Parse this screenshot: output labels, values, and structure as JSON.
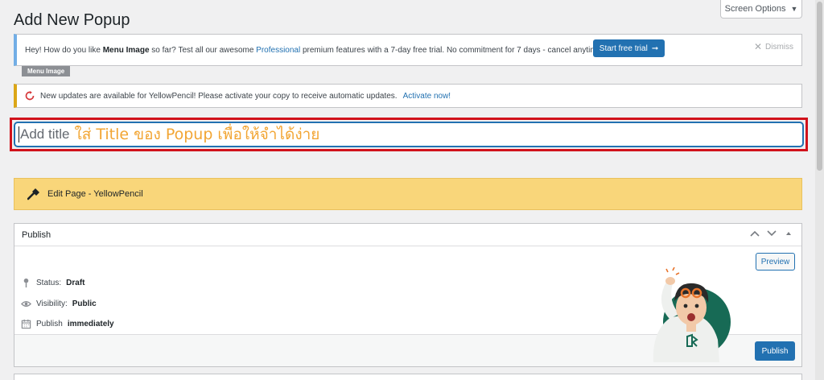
{
  "page": {
    "title": "Add New Popup"
  },
  "screen_options": {
    "label": "Screen Options",
    "caret_icon": "caret-down-icon"
  },
  "info_notice": {
    "text_1": "Hey! How do you like ",
    "product": "Menu Image",
    "text_2": " so far? Test all our awesome ",
    "link": "Professional",
    "text_3": " premium features with a 7-day free trial. No commitment for 7 days - cancel anytime!",
    "button_label": "Start free trial",
    "button_icon": "arrow-right-icon",
    "dismiss_label": "Dismiss",
    "accent_color": "#72aee6"
  },
  "menu_image_tag": "Menu Image",
  "update_notice": {
    "text": "New updates are available for YellowPencil! Please activate your copy to receive automatic updates.",
    "link": "Activate now!",
    "icon": "refresh-icon",
    "accent_color": "#dba617"
  },
  "title_field": {
    "placeholder": "Add title",
    "annotation": "ใส่ Title ของ Popup เพื่อให้จำได้ง่าย",
    "highlight_color": "#d1121b"
  },
  "yellowpencil": {
    "label": "Edit Page - YellowPencil",
    "icon": "hammer-icon",
    "color": "#f9d67a"
  },
  "publish_box": {
    "title": "Publish",
    "preview_label": "Preview",
    "status_label": "Status:",
    "status_value": "Draft",
    "visibility_label": "Visibility:",
    "visibility_value": "Public",
    "publish_label": "Publish",
    "publish_value": "immediately",
    "publish_button": "Publish",
    "accent_color": "#2271b1"
  }
}
